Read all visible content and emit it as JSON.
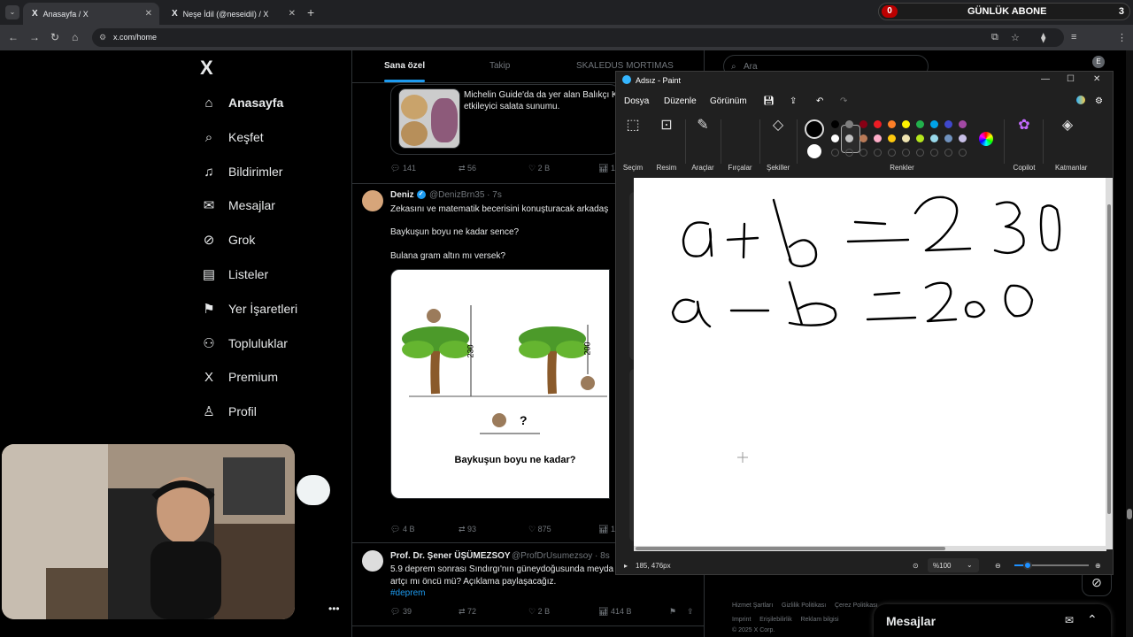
{
  "browser": {
    "tabs": [
      {
        "title": "Anasayfa / X",
        "active": true
      },
      {
        "title": "Neşe İdil (@neseidil) / X",
        "active": false
      }
    ],
    "url": "x.com/home",
    "profile_initial": "E",
    "abone_widget": {
      "left": "0",
      "label": "GÜNLÜK ABONE",
      "right": "3"
    }
  },
  "x": {
    "nav": [
      {
        "label": "Anasayfa",
        "icon": "home-icon",
        "glyph": "⌂"
      },
      {
        "label": "Keşfet",
        "icon": "search-icon",
        "glyph": "⌕"
      },
      {
        "label": "Bildirimler",
        "icon": "bell-icon",
        "glyph": "♫"
      },
      {
        "label": "Mesajlar",
        "icon": "mail-icon",
        "glyph": "✉"
      },
      {
        "label": "Grok",
        "icon": "grok-icon",
        "glyph": "⊘"
      },
      {
        "label": "Listeler",
        "icon": "list-icon",
        "glyph": "▤"
      },
      {
        "label": "Yer İşaretleri",
        "icon": "bookmark-icon",
        "glyph": "⚑"
      },
      {
        "label": "Topluluklar",
        "icon": "communities-icon",
        "glyph": "⚇"
      },
      {
        "label": "Premium",
        "icon": "x-premium-icon",
        "glyph": "X"
      },
      {
        "label": "Profil",
        "icon": "profile-icon",
        "glyph": "♙"
      }
    ],
    "feed_tabs": [
      "Sana özel",
      "Takip",
      "SKALEDUS MORTIMAS"
    ],
    "card_text": "Michelin Guide'da da yer alan Balıkçı K etkileyici salata sunumu.",
    "post1_actions": {
      "replies": "141",
      "reposts": "56",
      "likes": "2 B",
      "views": "1"
    },
    "post2": {
      "name": "Deniz",
      "handle": "@DenizBrn35 · 7s",
      "lines": [
        "Zekasını ve matematik becerisini konuşturacak arkadaş",
        "Baykuşun boyu ne kadar sence?",
        "Bulana gram altın mı versek?"
      ],
      "image": {
        "dim1": "230",
        "dim2": "200",
        "question": "?",
        "caption": "Baykuşun boyu ne kadar?"
      },
      "actions": {
        "replies": "4 B",
        "reposts": "93",
        "likes": "875",
        "views": "1"
      }
    },
    "post3": {
      "name": "Prof. Dr. Şener ÜŞÜMEZSOY",
      "handle": "@ProfDrUsumezsoy · 8s",
      "lines": [
        "5.9 deprem sonrası Sındırgı'nın güneydoğusunda meyda",
        "artçı mı öncü mü? Açıklama paylaşacağız."
      ],
      "hashtag": "#deprem",
      "actions": {
        "replies": "39",
        "reposts": "72",
        "likes": "2 B",
        "views": "414 B"
      }
    },
    "search_placeholder": "Ara",
    "footer": {
      "row1": [
        "Hizmet Şartları",
        "Gizlilik Politikası",
        "Çerez Politikası"
      ],
      "row2": [
        "Imprint",
        "Erişilebilirlik",
        "Reklam bilgisi"
      ],
      "copyright": "© 2025 X Corp."
    },
    "messages_label": "Mesajlar"
  },
  "paint": {
    "title": "Adsız - Paint",
    "menu": [
      "Dosya",
      "Düzenle",
      "Görünüm"
    ],
    "tools": [
      {
        "label": "Seçim",
        "icon": "selection-icon",
        "glyph": "⬚"
      },
      {
        "label": "Resim",
        "icon": "image-icon",
        "glyph": "⊡"
      },
      {
        "label": "Araçlar",
        "icon": "tools-icon",
        "glyph": "✎"
      },
      {
        "label": "Fırçalar",
        "icon": "brush-icon",
        "glyph": "🖌"
      },
      {
        "label": "Şekiller",
        "icon": "shapes-icon",
        "glyph": "◇"
      },
      {
        "label": "Renkler",
        "icon": "colors-icon",
        "glyph": ""
      },
      {
        "label": "Copilot",
        "icon": "copilot-icon",
        "glyph": "✿"
      },
      {
        "label": "Katmanlar",
        "icon": "layers-icon",
        "glyph": "◈"
      }
    ],
    "palette_row1": [
      "#000000",
      "#7f7f7f",
      "#880015",
      "#ed1c24",
      "#ff7f27",
      "#fff200",
      "#22b14c",
      "#00a2e8",
      "#3f48cc",
      "#a349a4"
    ],
    "palette_row2": [
      "#ffffff",
      "#c3c3c3",
      "#b97a57",
      "#ffaec9",
      "#ffc90e",
      "#efe4b0",
      "#b5e61d",
      "#99d9ea",
      "#7092be",
      "#c8bfe7"
    ],
    "equations": [
      "a + b = 230",
      "a - b = 200"
    ],
    "status": {
      "coords": "185, 476px",
      "zoom": "%100"
    }
  }
}
